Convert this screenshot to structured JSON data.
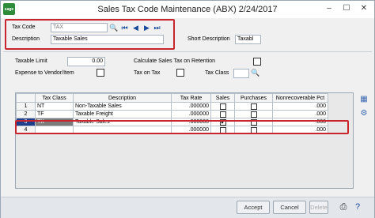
{
  "window": {
    "title": "Sales Tax Code Maintenance (ABX) 2/24/2017",
    "app_icon_text": "sage"
  },
  "header": {
    "tax_code_label": "Tax Code",
    "tax_code_value": "TAX",
    "description_label": "Description",
    "description_value": "Taxable Sales",
    "short_description_label": "Short Description",
    "short_description_value": "Taxabl"
  },
  "settings": {
    "taxable_limit_label": "Taxable Limit",
    "taxable_limit_value": "0.00",
    "expense_to_vendor_label": "Expense to Vendor/Item",
    "calc_on_retention_label": "Calculate Sales Tax on Retention",
    "tax_on_tax_label": "Tax on Tax",
    "tax_class_label": "Tax Class",
    "tax_class_value": ""
  },
  "grid": {
    "columns": [
      "Tax Class",
      "Description",
      "Tax Rate",
      "Sales",
      "Purchases",
      "Nonrecoverable Pct"
    ],
    "rows": [
      {
        "num": "1",
        "tax_class": "NT",
        "description": "Non-Taxable Sales",
        "tax_rate": ".000000",
        "sales": false,
        "purchases": false,
        "nonrecoverable": ".000"
      },
      {
        "num": "2",
        "tax_class": "TF",
        "description": "Taxable Freight",
        "tax_rate": ".000000",
        "sales": false,
        "purchases": false,
        "nonrecoverable": ".000"
      },
      {
        "num": "3",
        "tax_class": "TX",
        "description": "Taxable Sales",
        "tax_rate": ".000000",
        "sales": true,
        "purchases": false,
        "nonrecoverable": ".000"
      },
      {
        "num": "4",
        "tax_class": "",
        "description": "",
        "tax_rate": ".000000",
        "sales": false,
        "purchases": false,
        "nonrecoverable": ".000"
      }
    ]
  },
  "buttons": {
    "accept": "Accept",
    "cancel": "Cancel",
    "delete": "Delete"
  },
  "colors": {
    "highlight_border": "#c9252f",
    "selected_row": "#1f3f8c"
  }
}
